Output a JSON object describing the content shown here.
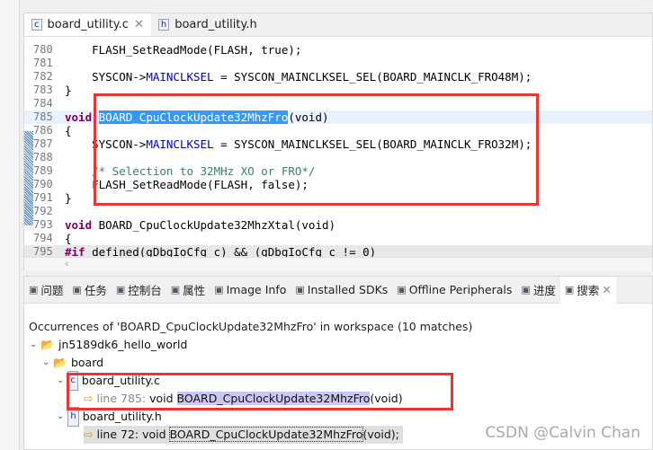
{
  "editor": {
    "tabs": [
      {
        "label": "board_utility.c",
        "icon": "c-file-icon",
        "active": true
      },
      {
        "label": "board_utility.h",
        "icon": "h-file-icon",
        "active": false
      }
    ],
    "lines": [
      {
        "n": "780",
        "t": "    FLASH_SetReadMode(FLASH, true);"
      },
      {
        "n": "781",
        "t": ""
      },
      {
        "n": "782",
        "pre": "    SYSCON->",
        "fld": "MAINCLKSEL",
        "post": " = SYSCON_MAINCLKSEL_SEL(BOARD_MAINCLK_FRO48M);"
      },
      {
        "n": "783",
        "t": "}"
      },
      {
        "n": "784",
        "t": ""
      },
      {
        "n": "785",
        "kw": "void",
        "sel": "BOARD_CpuClockUpdate32MhzFro",
        "post": "(void)"
      },
      {
        "n": "786",
        "t": "{"
      },
      {
        "n": "787",
        "pre": "    SYSCON->",
        "fld": "MAINCLKSEL",
        "post": " = SYSCON_MAINCLKSEL_SEL(BOARD_MAINCLK_FRO32M);"
      },
      {
        "n": "788",
        "t": ""
      },
      {
        "n": "789",
        "cm": "    /* Selection to 32MHz XO or FRO*/"
      },
      {
        "n": "790",
        "t": "    FLASH_SetReadMode(FLASH, false);"
      },
      {
        "n": "791",
        "t": "}"
      },
      {
        "n": "792",
        "t": ""
      },
      {
        "n": "793",
        "kw": "void",
        "post": " BOARD_CpuClockUpdate32MhzXtal(void)"
      },
      {
        "n": "794",
        "t": "{"
      },
      {
        "n": "795",
        "kw": "#if",
        "post": " defined(gDbgIoCfg_c) && (gDbgIoCfg_c != 0)"
      }
    ]
  },
  "panel": {
    "tabs": [
      {
        "label": "问题",
        "icon": "problems-icon"
      },
      {
        "label": "任务",
        "icon": "tasks-icon"
      },
      {
        "label": "控制台",
        "icon": "console-icon"
      },
      {
        "label": "属性",
        "icon": "properties-icon"
      },
      {
        "label": "Image Info",
        "icon": "image-info-icon"
      },
      {
        "label": "Installed SDKs",
        "icon": "sdk-icon"
      },
      {
        "label": "Offline Peripherals",
        "icon": "peripherals-icon"
      },
      {
        "label": "进度",
        "icon": "progress-icon"
      },
      {
        "label": "搜索",
        "icon": "search-icon",
        "active": true
      }
    ],
    "occurrences": "Occurrences of 'BOARD_CpuClockUpdate32MhzFro' in workspace (10 matches)",
    "tree": {
      "project": "jn5189dk6_hello_world",
      "folder": "board",
      "file_c": "board_utility.c",
      "line_c": "line 785:",
      "line_c_pre": "void ",
      "line_c_match": "BOARD_CpuClockUpdate32MhzFro",
      "line_c_post": "(void)",
      "file_h": "board_utility.h",
      "line_h": "line 72:",
      "line_h_pre": "void ",
      "line_h_match": "BOARD_CpuClockUpdate32MhzFro",
      "line_h_post": "(void);"
    }
  },
  "watermark": "CSDN @Calvin Chan",
  "colors": {
    "highlight_box": "#ee3333",
    "selection": "#3399ff"
  }
}
